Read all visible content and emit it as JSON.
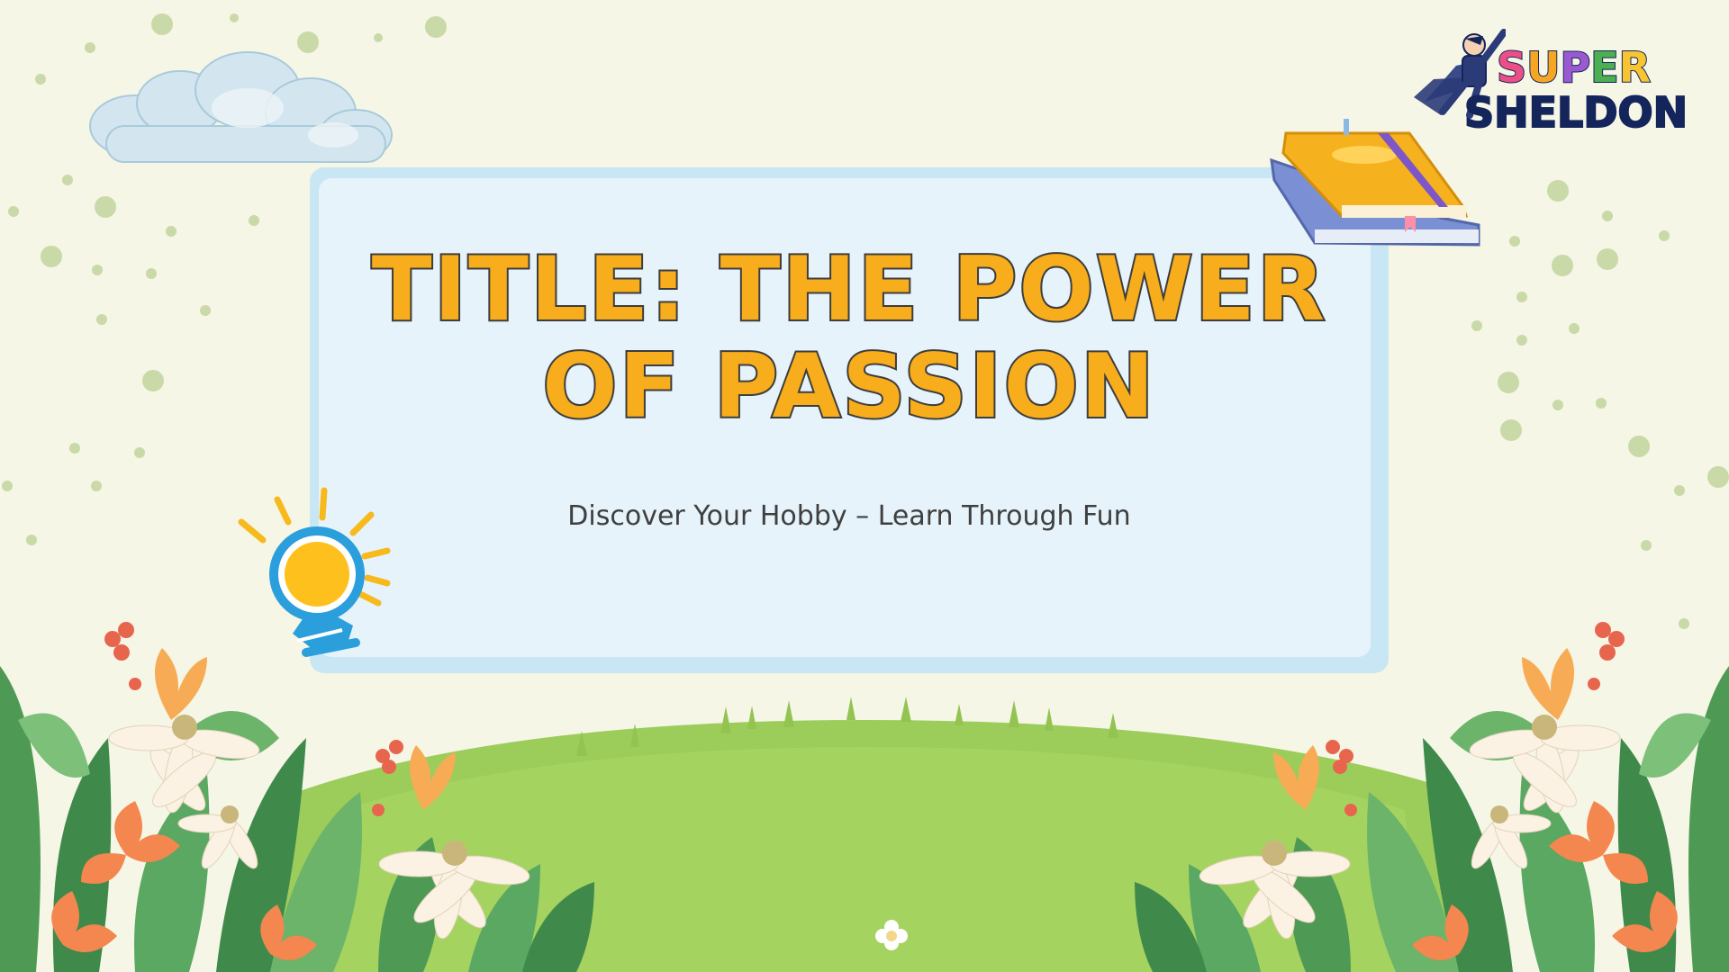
{
  "slide": {
    "title": "TITLE: THE POWER OF PASSION",
    "subtitle": "Discover Your Hobby – Learn Through Fun"
  },
  "logo": {
    "line1_letters": [
      "S",
      "U",
      "P",
      "E",
      "R"
    ],
    "line1_colors": [
      "#ec4f85",
      "#f5a623",
      "#9b59d0",
      "#4caf50",
      "#f6c531"
    ],
    "line2": "SHELDON"
  },
  "colors": {
    "background": "#f5f6e6",
    "card_border": "#c8e6f3",
    "card_fill": "#e6f3fa",
    "title_fill": "#f7ad1c",
    "title_stroke": "#3d3d3d",
    "subtitle": "#3f3f3f",
    "logo_navy": "#14255c"
  },
  "icons": [
    "cloud-icon",
    "books-icon",
    "lightbulb-icon",
    "superhero-icon",
    "globe-icon",
    "flowers-icon",
    "grass-hill-icon",
    "dots-decoration-icon"
  ]
}
